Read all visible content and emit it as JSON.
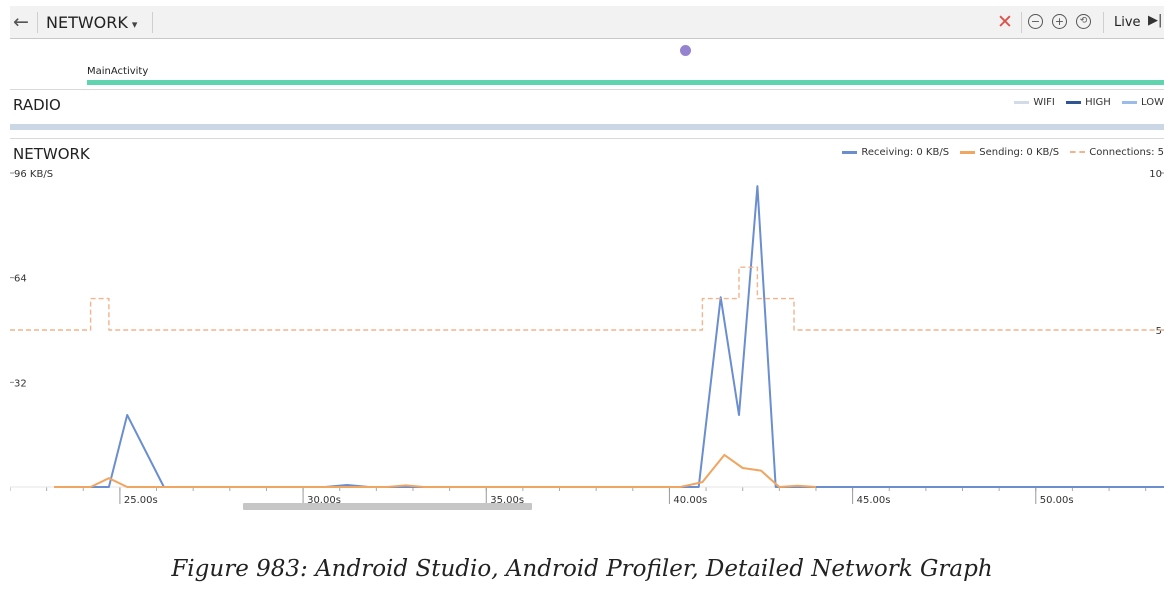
{
  "toolbar": {
    "back_icon": "left-arrow-icon",
    "title": "NETWORK",
    "caret": "▾",
    "stop_icon": "close-icon",
    "zoom_out_icon": "zoom-out-icon",
    "zoom_in_icon": "zoom-in-icon",
    "reset_zoom_icon": "reset-zoom-icon",
    "live_label": "Live",
    "skip_icon": "skip-to-end-icon"
  },
  "activity": {
    "name": "MainActivity",
    "bar_color": "#5fd4ae",
    "event_dot_color": "#9583cf"
  },
  "radio": {
    "title": "RADIO",
    "legend": [
      {
        "label": "WIFI",
        "color": "#d3dbe8"
      },
      {
        "label": "HIGH",
        "color": "#2f5596"
      },
      {
        "label": "LOW",
        "color": "#9bbbe8"
      }
    ]
  },
  "network": {
    "title": "NETWORK",
    "legend": {
      "receiving": "Receiving: 0 KB/S",
      "sending": "Sending: 0 KB/S",
      "connections": "Connections: 5"
    }
  },
  "chart_data": {
    "type": "line",
    "title": "NETWORK",
    "colors": {
      "receiving": "#6a8ed0",
      "sending": "#f0a560",
      "connections": "#f2b48c"
    },
    "ylabel_left": "96 KB/S",
    "y_ticks_left": [
      "96 KB/S",
      "64",
      "32"
    ],
    "ylim_left": [
      0,
      96
    ],
    "y_ticks_right": [
      "10",
      "5"
    ],
    "ylim_right": [
      0,
      10
    ],
    "xlim_s": [
      22.0,
      53.5
    ],
    "x_tick_labels": [
      "25.00s",
      "30.00s",
      "35.00s",
      "40.00s",
      "45.00s",
      "50.00s"
    ],
    "x_tick_values": [
      25,
      30,
      35,
      40,
      45,
      50
    ],
    "series": [
      {
        "name": "Receiving",
        "axis": "left",
        "x": [
          23.2,
          24.7,
          25.2,
          26.2,
          29.5,
          30.6,
          31.2,
          31.8,
          40.8,
          41.4,
          41.9,
          42.4,
          42.9,
          53.5
        ],
        "y": [
          0,
          0,
          22,
          0,
          0,
          0,
          0.6,
          0,
          0,
          58,
          22,
          92,
          0,
          0
        ]
      },
      {
        "name": "Sending",
        "axis": "left",
        "x": [
          23.2,
          24.2,
          24.7,
          25.2,
          32.3,
          32.8,
          33.3,
          40.3,
          40.9,
          41.5,
          42.0,
          42.5,
          43.0,
          43.5,
          44.0
        ],
        "y": [
          0,
          0,
          2.7,
          0,
          0,
          0.5,
          0,
          0,
          1.5,
          9.8,
          5.8,
          5.0,
          0,
          0.4,
          0
        ]
      },
      {
        "name": "Connections",
        "axis": "right",
        "dashed": true,
        "x": [
          22.0,
          24.2,
          24.2,
          24.7,
          24.7,
          40.9,
          40.9,
          41.9,
          41.9,
          42.4,
          42.4,
          43.4,
          43.4,
          53.5
        ],
        "y": [
          5,
          5,
          6,
          6,
          5,
          5,
          6,
          6,
          7,
          7,
          6,
          6,
          5,
          5
        ]
      }
    ]
  },
  "caption": "Figure 983: Android Studio, Android Profiler, Detailed Network Graph"
}
